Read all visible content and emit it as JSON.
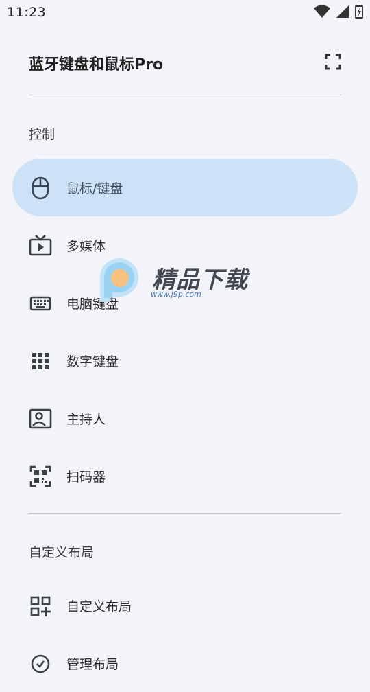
{
  "status_bar": {
    "time": "11:23"
  },
  "header": {
    "title": "蓝牙键盘和鼠标Pro"
  },
  "sections": [
    {
      "title": "控制"
    },
    {
      "title": "自定义布局"
    }
  ],
  "control_items": [
    {
      "label": "鼠标/键盘",
      "icon": "mouse-icon",
      "active": true
    },
    {
      "label": "多媒体",
      "icon": "tv-icon"
    },
    {
      "label": "电脑键盘",
      "icon": "keyboard-icon"
    },
    {
      "label": "数字键盘",
      "icon": "numpad-grid-icon"
    },
    {
      "label": "主持人",
      "icon": "presenter-icon"
    },
    {
      "label": "扫码器",
      "icon": "qr-scanner-icon"
    }
  ],
  "layout_items": [
    {
      "label": "自定义布局",
      "icon": "add-grid-icon"
    },
    {
      "label": "管理布局",
      "icon": "manage-icon"
    }
  ],
  "watermark": {
    "text": "精品下载",
    "url": "www.j9p.com"
  },
  "colors": {
    "background": "#f3f4f9",
    "active_item": "#cde1f7",
    "icon": "#3b3f46"
  }
}
